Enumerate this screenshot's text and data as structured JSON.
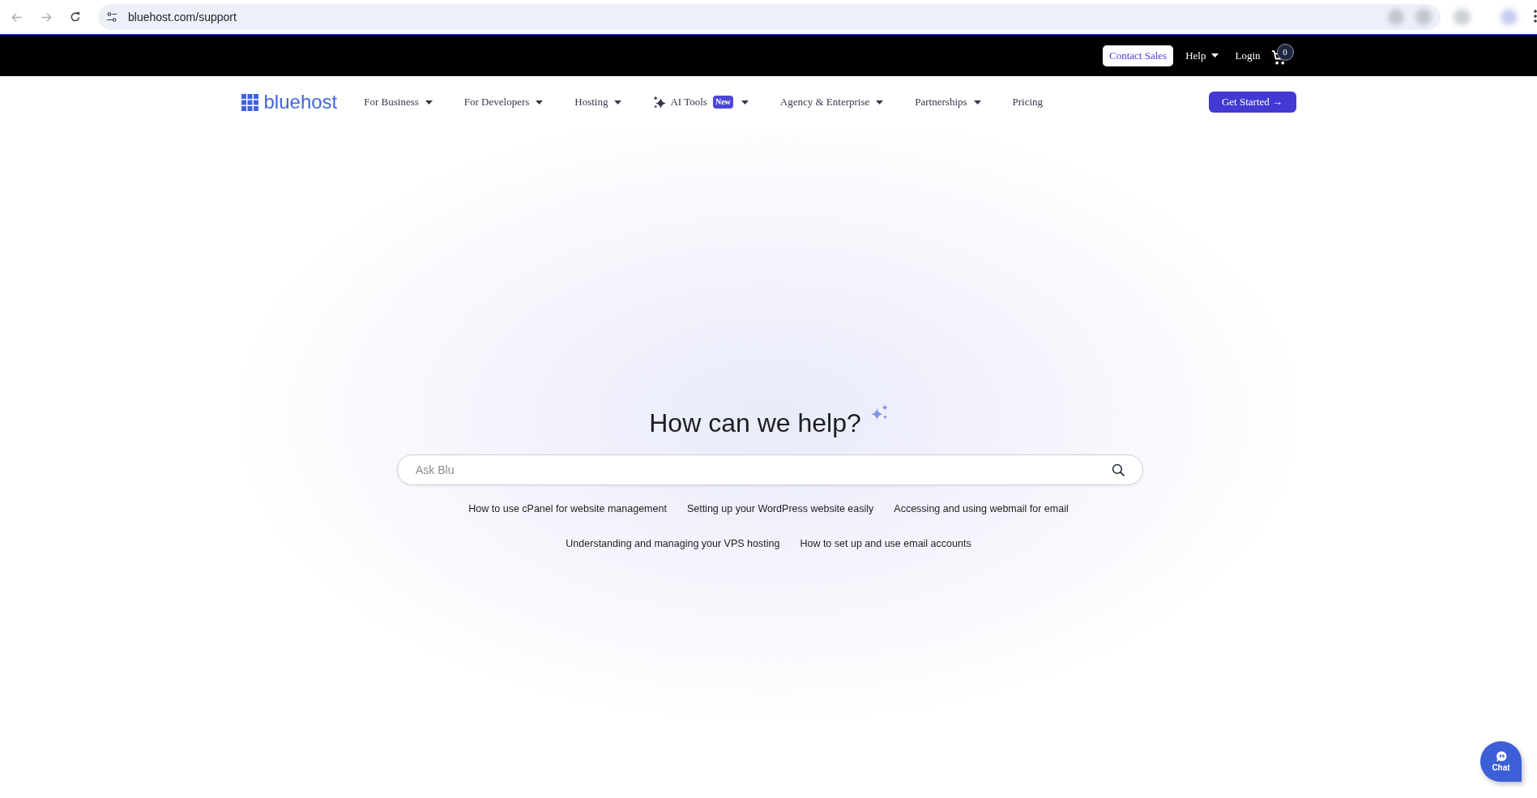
{
  "browser": {
    "back": {
      "disabled": true
    },
    "forward": {
      "disabled": true
    },
    "url": "bluehost.com/support"
  },
  "top_bar": {
    "contact_sales": "Contact Sales",
    "links": [
      {
        "label": "Help",
        "dropdown": true
      },
      {
        "label": "Login",
        "dropdown": false
      }
    ],
    "cart": {
      "count": "0"
    }
  },
  "nav": {
    "logo": "bluehost",
    "items": [
      {
        "label": "For Business",
        "kind": "menu",
        "dropdown": true
      },
      {
        "label": "For Developers",
        "kind": "menu",
        "dropdown": true
      },
      {
        "label": "Hosting",
        "kind": "menu",
        "dropdown": true
      },
      {
        "label": "AI Tools",
        "kind": "ai",
        "badge": "New",
        "dropdown": true
      },
      {
        "label": "Agency & Enterprise",
        "kind": "menu",
        "dropdown": true
      },
      {
        "label": "Partnerships",
        "kind": "menu",
        "dropdown": true
      },
      {
        "label": "Pricing",
        "kind": "menu",
        "dropdown": false
      }
    ],
    "cta": "Get Started →"
  },
  "hero": {
    "title": "How can we help?",
    "search": {
      "placeholder": "Ask Blu"
    },
    "suggestions": [
      "How to use cPanel for website management",
      "Setting up your WordPress website easily",
      "Accessing and using webmail for email",
      "Understanding and managing your VPS hosting",
      "How to set up and use email accounts"
    ]
  },
  "chat": {
    "label": "Chat"
  }
}
